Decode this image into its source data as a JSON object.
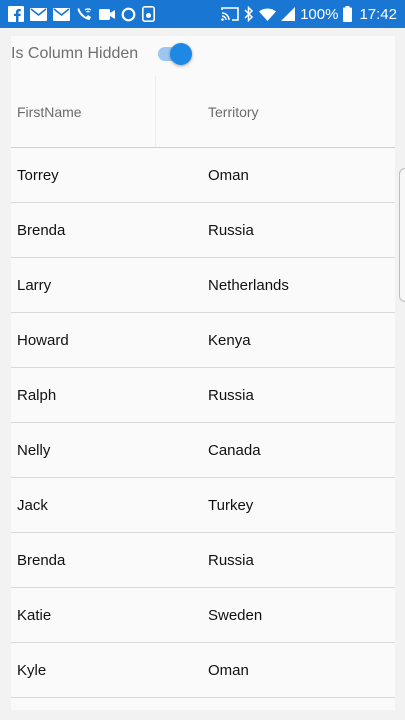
{
  "status_bar": {
    "battery_text": "100%",
    "time": "17:42",
    "left_icons": [
      "facebook-icon",
      "mail-icon",
      "mail-icon",
      "wifi-call-icon",
      "video-icon",
      "circle-icon",
      "phone-app-icon"
    ],
    "right_icons": [
      "cast-icon",
      "bluetooth-icon",
      "wifi-icon",
      "signal-icon",
      "battery-icon"
    ]
  },
  "toggle": {
    "label": "Is Column Hidden",
    "on": true
  },
  "grid": {
    "columns": [
      "FirstName",
      "Territory"
    ],
    "rows": [
      {
        "first": "Torrey",
        "territory": "Oman"
      },
      {
        "first": "Brenda",
        "territory": "Russia"
      },
      {
        "first": "Larry",
        "territory": "Netherlands"
      },
      {
        "first": "Howard",
        "territory": "Kenya"
      },
      {
        "first": "Ralph",
        "territory": "Russia"
      },
      {
        "first": "Nelly",
        "territory": "Canada"
      },
      {
        "first": "Jack",
        "territory": "Turkey"
      },
      {
        "first": "Brenda",
        "territory": "Russia"
      },
      {
        "first": "Katie",
        "territory": "Sweden"
      },
      {
        "first": "Kyle",
        "territory": "Oman"
      }
    ]
  },
  "colors": {
    "status_bar": "#1976d2",
    "accent": "#1e88e5",
    "accent_track": "#9ec6f2"
  }
}
